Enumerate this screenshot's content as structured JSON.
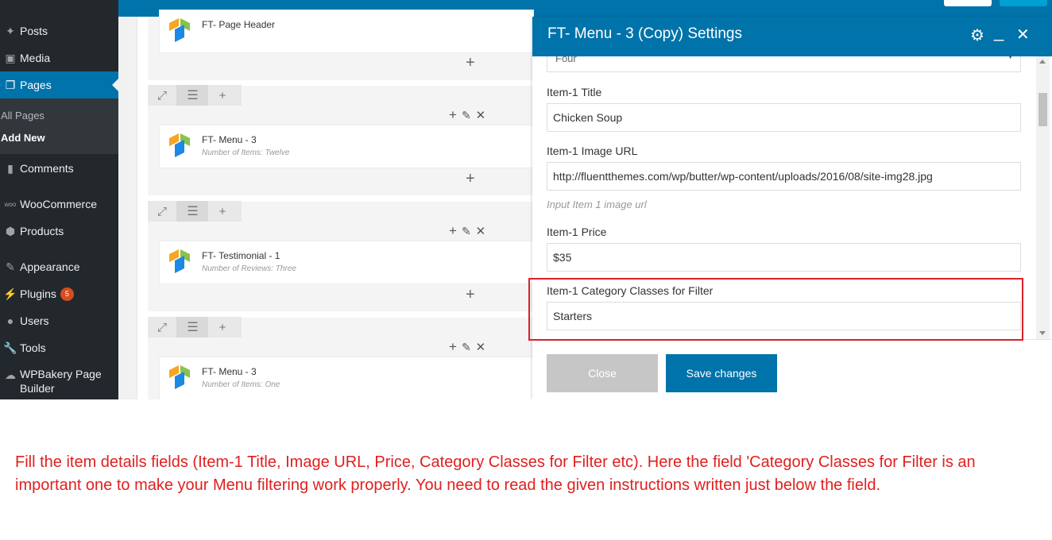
{
  "sidebar": {
    "items": [
      {
        "label": "Posts",
        "icon": "pushpin-icon"
      },
      {
        "label": "Media",
        "icon": "media-icon"
      },
      {
        "label": "Pages",
        "icon": "pages-icon"
      },
      {
        "label": "Comments",
        "icon": "comment-icon"
      },
      {
        "label": "WooCommerce",
        "icon": "woocommerce-icon"
      },
      {
        "label": "Products",
        "icon": "products-icon"
      },
      {
        "label": "Appearance",
        "icon": "brush-icon"
      },
      {
        "label": "Plugins",
        "icon": "plugin-icon",
        "badge": "5"
      },
      {
        "label": "Users",
        "icon": "users-icon"
      },
      {
        "label": "Tools",
        "icon": "wrench-icon"
      },
      {
        "label": "WPBakery Page Builder",
        "icon": "wpbakery-icon"
      }
    ],
    "submenu": {
      "all_pages": "All Pages",
      "add_new": "Add New"
    }
  },
  "builder": {
    "elements": [
      {
        "title": "FT- Page Header",
        "subtitle": ""
      },
      {
        "title": "FT- Menu - 3",
        "subtitle": "Number of Items: Twelve"
      },
      {
        "title": "FT- Testimonial - 1",
        "subtitle": "Number of Reviews: Three"
      },
      {
        "title": "FT- Menu - 3",
        "subtitle": "Number of Items: One"
      }
    ]
  },
  "panel": {
    "title": "FT- Menu - 3 (Copy) Settings",
    "select_value": "Four",
    "fields": [
      {
        "label": "Item-1 Title",
        "value": "Chicken Soup"
      },
      {
        "label": "Item-1 Image URL",
        "value": "http://fluentthemes.com/wp/butter/wp-content/uploads/2016/08/site-img28.jpg",
        "help": "Input Item 1 image url"
      },
      {
        "label": "Item-1 Price",
        "value": "$35"
      },
      {
        "label": "Item-1 Category Classes for Filter",
        "value": "Starters"
      }
    ],
    "close_label": "Close",
    "save_label": "Save changes"
  },
  "colors": {
    "accent": "#0073aa",
    "sidebar": "#23282d",
    "highlight": "#d9202a",
    "caption": "#e02020"
  },
  "caption": "Fill the item details fields (Item-1 Title, Image URL, Price, Category Classes for Filter etc). Here the field 'Category Classes for Filter is an important one to make your Menu filtering work properly. You need to read the given instructions written just below the field."
}
